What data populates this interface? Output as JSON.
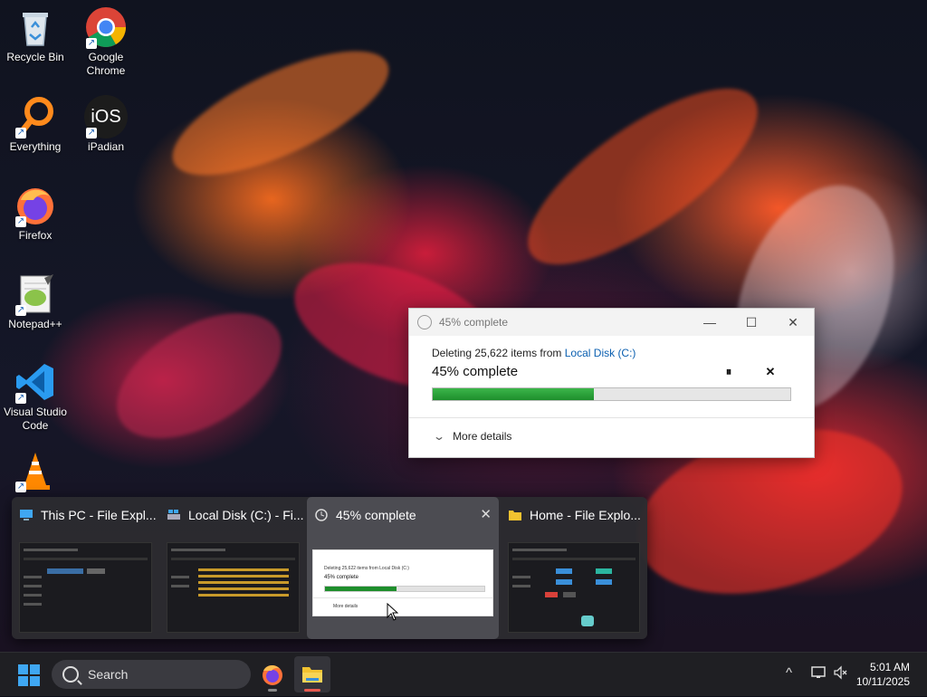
{
  "desktop": {
    "icons": [
      {
        "label": "Recycle Bin"
      },
      {
        "label": "Google\nChrome"
      },
      {
        "label": "Everything"
      },
      {
        "label": "iPadian"
      },
      {
        "label": "Firefox"
      },
      {
        "label": "Notepad++"
      },
      {
        "label": "Visual Studio\nCode"
      },
      {
        "label": "VLC"
      }
    ],
    "ipadian_text": "iOS"
  },
  "dialog": {
    "title": "45% complete",
    "line1_prefix": "Deleting 25,622 items from ",
    "line1_link": "Local Disk (C:)",
    "percent_label": "45% complete",
    "progress": 0.45,
    "pause_glyph": "⏸",
    "cancel_glyph": "✕",
    "more_details": "More details",
    "minimize": "—",
    "maximize": "☐",
    "close": "✕",
    "accent": "#1e8e2c",
    "link_color": "#0a5fb0"
  },
  "switcher": {
    "windows": [
      {
        "title": "This PC - File Expl...",
        "icon": "monitor-icon"
      },
      {
        "title": "Local Disk (C:) - Fi...",
        "icon": "drive-icon"
      },
      {
        "title": "45% complete",
        "icon": "clock-icon",
        "active": true
      },
      {
        "title": "Home - File Explo...",
        "icon": "folder-icon"
      }
    ],
    "close_glyph": "✕",
    "thumb_dialog_line1": "Deleting 25,622 items from Local Disk (C:)",
    "thumb_dialog_line2": "45% complete",
    "thumb_dialog_more": "More details"
  },
  "taskbar": {
    "search_placeholder": "Search",
    "time": "5:01 AM",
    "date": "10/11/2025",
    "tray_chevron": "^"
  }
}
